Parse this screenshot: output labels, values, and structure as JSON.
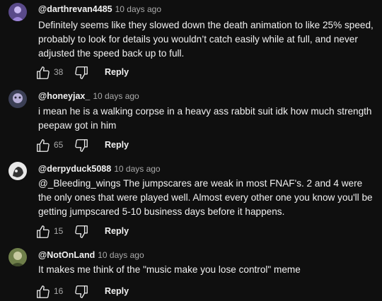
{
  "comments": [
    {
      "handle": "@darthrevan4485",
      "time": "10 days ago",
      "text": "Definitely seems like they slowed down the death animation to like 25% speed, probably to look for details you wouldn’t catch easily while at full, and never adjusted the speed back up to full.",
      "likes": "38",
      "reply_label": "Reply"
    },
    {
      "handle": "@honeyjax_",
      "time": "10 days ago",
      "text": "i mean he is a walking corpse in a heavy ass rabbit suit idk how much strength peepaw got in him",
      "likes": "65",
      "reply_label": "Reply"
    },
    {
      "handle": "@derpyduck5088",
      "time": "10 days ago",
      "text": "@_Bleeding_wings The jumpscares are weak in most FNAF's. 2 and 4 were the only ones that were played well. Almost every other one you know you'll be getting jumpscared 5-10 business days before it happens.",
      "likes": "15",
      "reply_label": "Reply"
    },
    {
      "handle": "@NotOnLand",
      "time": "10 days ago",
      "text": "It makes me think of the \"music make you lose control\" meme",
      "likes": "16",
      "reply_label": "Reply"
    }
  ]
}
